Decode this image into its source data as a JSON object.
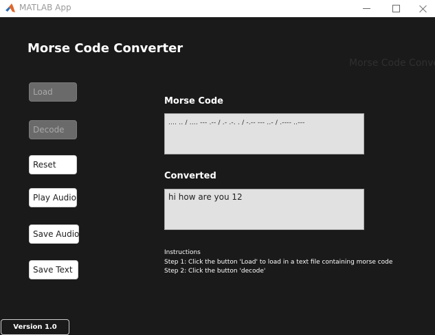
{
  "window": {
    "title": "MATLAB App",
    "app_icon": "matlab-logo-icon",
    "controls": [
      "minimize-icon",
      "maximize-icon",
      "close-icon"
    ]
  },
  "app": {
    "heading": "Morse Code Converter",
    "ghost_heading": "Morse Code Convert"
  },
  "buttons": {
    "load": "Load",
    "decode": "Decode",
    "reset": "Reset",
    "play_audio": "Play Audio",
    "save_audio": "Save Audio",
    "save_text": "Save Text"
  },
  "morse": {
    "label": "Morse Code",
    "value": ".... .. / .... --- .-- / .- .-. . / -.-- --- ..- / .---- ..---"
  },
  "converted": {
    "label": "Converted",
    "value": "hi how are you 12"
  },
  "instructions": {
    "title": "Instructions",
    "step1": "Step 1: Click the button 'Load' to load in a text file containing morse code",
    "step2": "Step 2: Click the button 'decode'"
  },
  "footer": {
    "version": "Version 1.0"
  },
  "colors": {
    "background": "#1a1a1a",
    "titlebar": "#ffffff",
    "textarea_bg": "#e1e1e1",
    "disabled_button": "#6a6a6a"
  }
}
